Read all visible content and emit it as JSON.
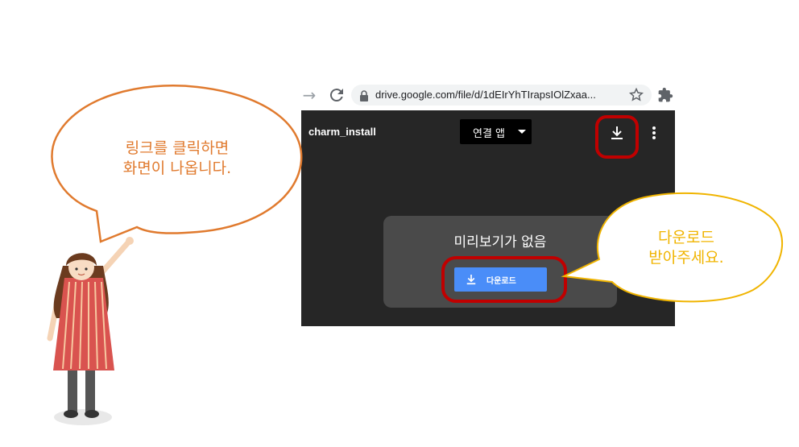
{
  "browser": {
    "url": "drive.google.com/file/d/1dEIrYhTIrapsIOlZxaa...",
    "icons": [
      "forward-arrow-icon",
      "reload-icon",
      "lock-icon",
      "star-icon",
      "extensions-puzzle-icon"
    ]
  },
  "drive": {
    "file_name": "charm_install",
    "open_with_label": "연결 앱",
    "no_preview_text": "미리보기가 없음",
    "download_button_label": "다운로드"
  },
  "annotations": {
    "left_bubble": {
      "line1": "링크를 클릭하면",
      "line2": "화면이 나옵니다."
    },
    "right_bubble": {
      "line1": "다운로드",
      "line2": "받아주세요."
    }
  },
  "colors": {
    "highlight": "#c00000",
    "left_bubble_text": "#e07a2e",
    "right_bubble_text": "#f0b400",
    "download_button": "#4a8df8",
    "viewer_bg": "#262626"
  }
}
